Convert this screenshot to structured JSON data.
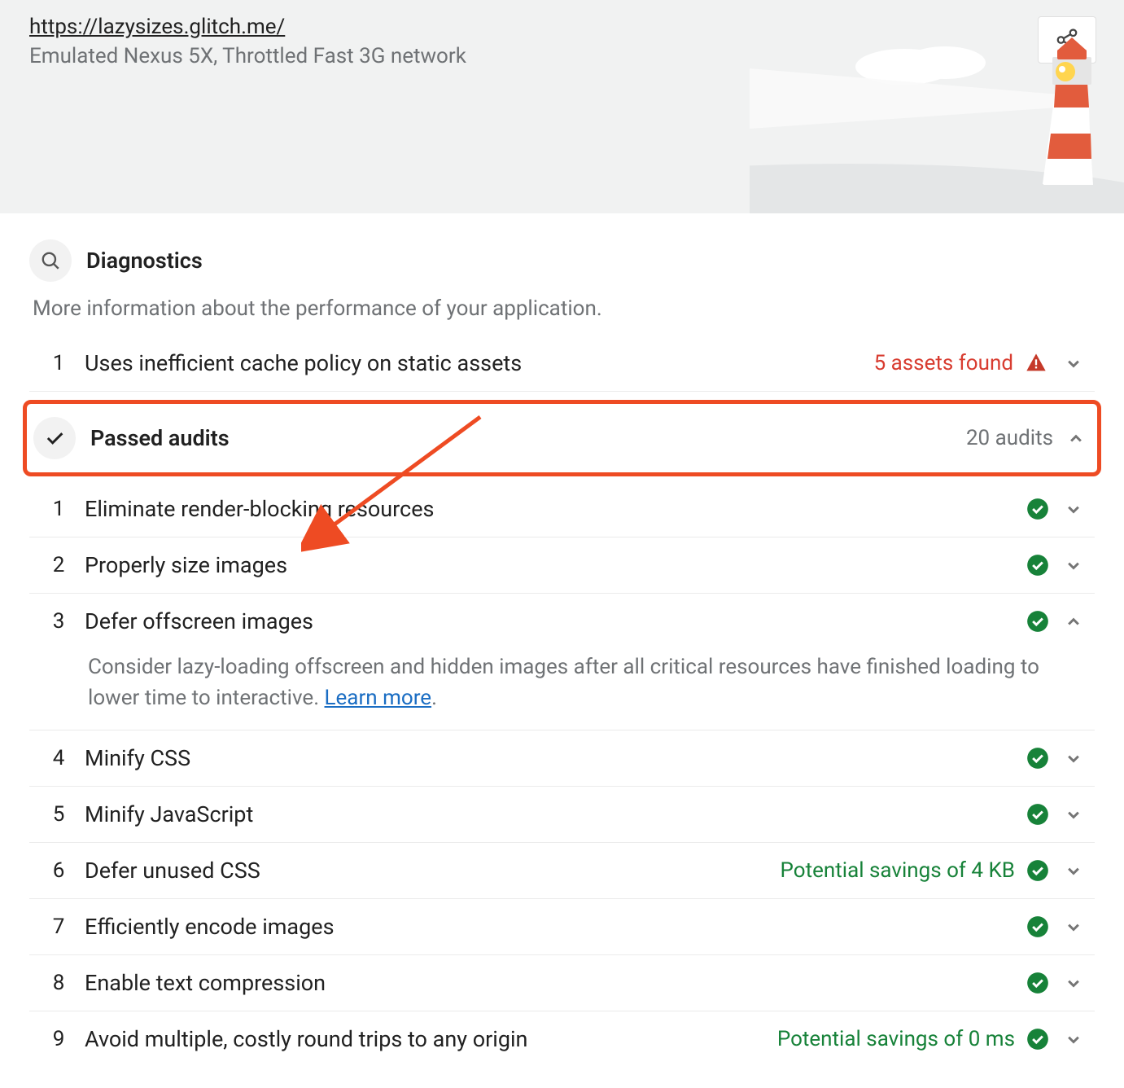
{
  "header": {
    "url": "https://lazysizes.glitch.me/",
    "emulated": "Emulated Nexus 5X, Throttled Fast 3G network"
  },
  "diagnostics": {
    "title": "Diagnostics",
    "description": "More information about the performance of your application.",
    "item": {
      "num": "1",
      "title": "Uses inefficient cache policy on static assets",
      "meta": "5 assets found"
    }
  },
  "passed": {
    "title": "Passed audits",
    "count": "20 audits",
    "items": [
      {
        "num": "1",
        "title": "Eliminate render-blocking resources",
        "meta": "",
        "expanded": false
      },
      {
        "num": "2",
        "title": "Properly size images",
        "meta": "",
        "expanded": false
      },
      {
        "num": "3",
        "title": "Defer offscreen images",
        "meta": "",
        "expanded": true,
        "desc_a": "Consider lazy-loading offscreen and hidden images after all critical resources have finished loading to lower time to interactive. ",
        "learn": "Learn more"
      },
      {
        "num": "4",
        "title": "Minify CSS",
        "meta": "",
        "expanded": false
      },
      {
        "num": "5",
        "title": "Minify JavaScript",
        "meta": "",
        "expanded": false
      },
      {
        "num": "6",
        "title": "Defer unused CSS",
        "meta": "Potential savings of 4 KB",
        "expanded": false
      },
      {
        "num": "7",
        "title": "Efficiently encode images",
        "meta": "",
        "expanded": false
      },
      {
        "num": "8",
        "title": "Enable text compression",
        "meta": "",
        "expanded": false
      },
      {
        "num": "9",
        "title": "Avoid multiple, costly round trips to any origin",
        "meta": "Potential savings of 0 ms",
        "expanded": false
      }
    ]
  }
}
